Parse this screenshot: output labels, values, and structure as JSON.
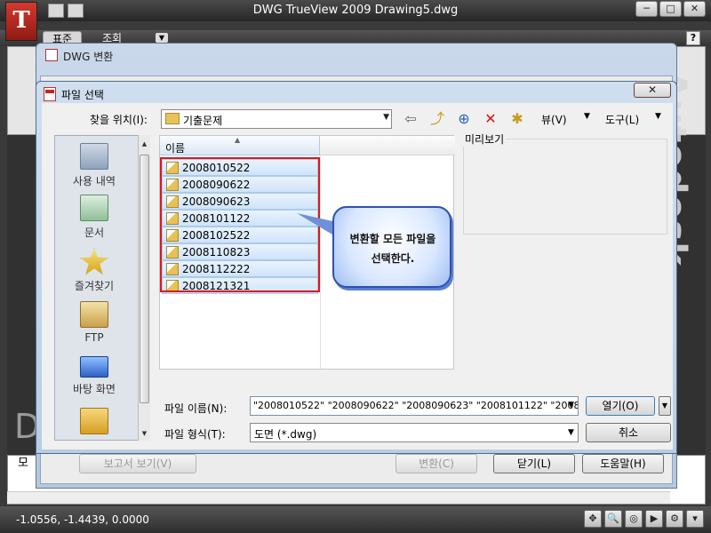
{
  "app": {
    "title": "DWG TrueView 2009 Drawing5.dwg",
    "logo": "T",
    "tabs": [
      "표준",
      "조회"
    ],
    "help": "?",
    "window_buttons": [
      "─",
      "□",
      "✕"
    ],
    "cmd_label": "모",
    "coords": "-1.0556, -1.4439, 0.0000",
    "brand_text": "Autodesk",
    "drawing_text": "DW"
  },
  "convert": {
    "title": "DWG 변환",
    "buttons": {
      "report": "보고서 보기(V)",
      "convert": "변환(C)",
      "close": "닫기(L)",
      "help": "도움말(H)"
    }
  },
  "dialog": {
    "title": "파일 선택",
    "close": "✕",
    "lookin_label": "찾을 위치(I):",
    "lookin_value": "기출문제",
    "view_menu": "뷰(V)",
    "tools_menu": "도구(L)",
    "places": [
      {
        "label": "사용 내역",
        "icon": "history-icon"
      },
      {
        "label": "문서",
        "icon": "documents-icon"
      },
      {
        "label": "즐겨찾기",
        "icon": "favorites-icon"
      },
      {
        "label": "FTP",
        "icon": "ftp-icon"
      },
      {
        "label": "바탕 화면",
        "icon": "desktop-icon"
      }
    ],
    "column_name": "이름",
    "files": [
      "2008010522",
      "2008090622",
      "2008090623",
      "2008101122",
      "2008102522",
      "2008110823",
      "2008112222",
      "2008121321"
    ],
    "preview_label": "미리보기",
    "callout_line1": "변환할 모든 파일을",
    "callout_line2": "선택한다.",
    "filename_label": "파일 이름(N):",
    "filename_value": "\"2008010522\" \"2008090622\" \"2008090623\" \"2008101122\" \"200810252",
    "open_button": "열기(O)",
    "filetype_label": "파일 형식(T):",
    "filetype_value": "도면 (*.dwg)",
    "cancel_button": "취소"
  }
}
